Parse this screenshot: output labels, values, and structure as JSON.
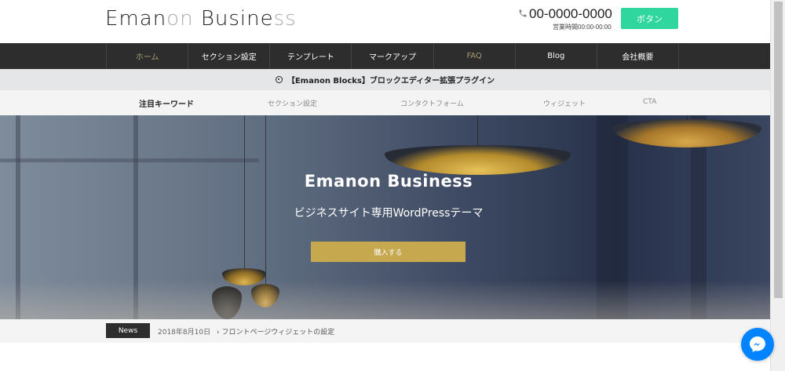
{
  "header": {
    "logo_dark_1": "Eman",
    "logo_light_1": "on",
    "logo_dark_2": " Busine",
    "logo_light_2": "ss",
    "phone": "00-0000-0000",
    "hours": "営業時間00:00-00:00",
    "cta_label": "ボタン"
  },
  "nav": {
    "items": [
      {
        "label": "ホーム"
      },
      {
        "label": "セクション設定"
      },
      {
        "label": "テンプレート"
      },
      {
        "label": "マークアップ"
      },
      {
        "label": "FAQ"
      },
      {
        "label": "Blog"
      },
      {
        "label": "会社概要"
      }
    ]
  },
  "notice": {
    "text": "【Emanon Blocks】ブロックエディター拡張プラグイン"
  },
  "keywords": {
    "heading": "注目キーワード",
    "items": [
      {
        "label": "セクション設定"
      },
      {
        "label": "コンタクトフォーム"
      },
      {
        "label": "ウィジェット"
      },
      {
        "label": "CTA"
      }
    ]
  },
  "hero": {
    "title": "Emanon Business",
    "subtitle": "ビジネスサイト専用WordPressテーマ",
    "button_label": "購入する"
  },
  "news": {
    "label": "News",
    "date": "2018年8月10日",
    "link": "› フロントページウィジェットの設定"
  },
  "colors": {
    "accent_green": "#2fd79f",
    "nav_bg": "#2d2d2d",
    "gold": "#c6a84f",
    "messenger_blue": "#0084ff"
  },
  "icons": {
    "phone": "phone-icon",
    "notice": "circle-dot-icon",
    "fab": "messenger-icon"
  }
}
